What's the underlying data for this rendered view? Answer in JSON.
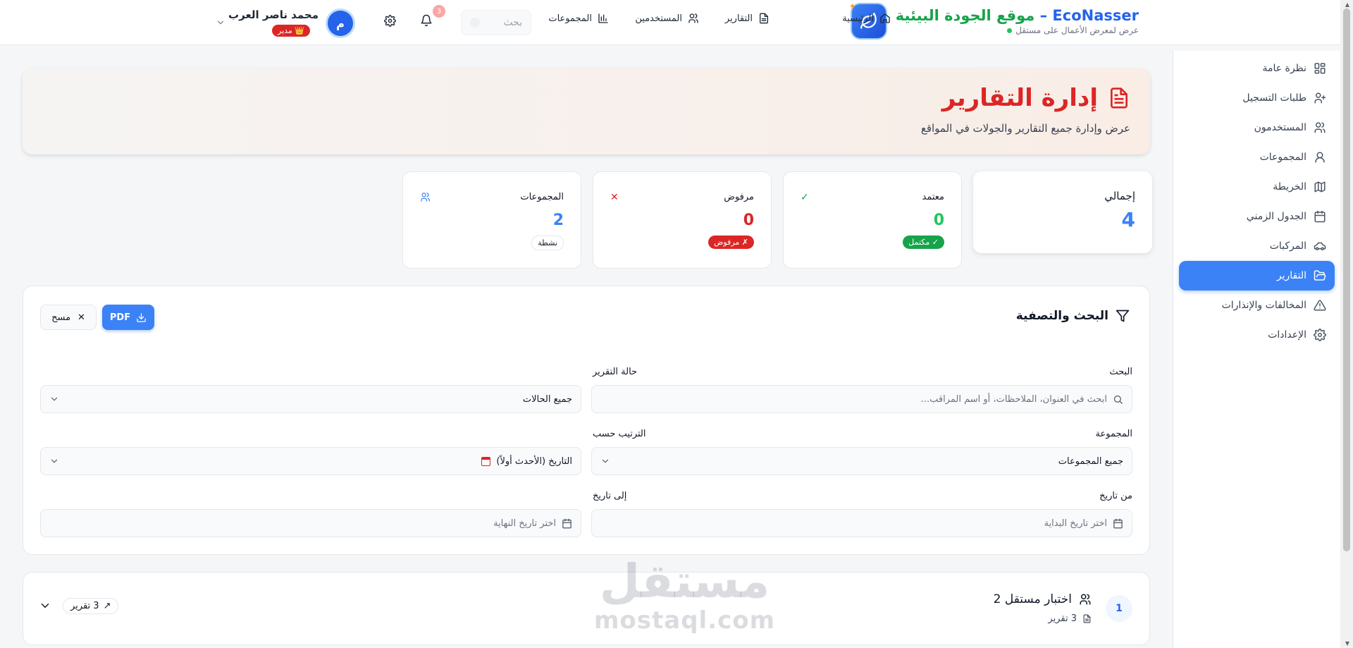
{
  "brand": {
    "title_en": "EcoNasser",
    "title_sep": " – ",
    "title_ar": "موقع الجودة البيئية",
    "subtitle": "عرض لمعرض الأعمال على مستقل"
  },
  "nav": {
    "home": "الرئيسية",
    "reports": "التقارير",
    "users": "المستخدمين",
    "groups": "المجموعات"
  },
  "search": {
    "placeholder": "بحث"
  },
  "notifications": {
    "count": "3"
  },
  "user": {
    "initial": "م",
    "name": "محمد ناصر العرب",
    "role": "👑 مدير"
  },
  "sidebar": {
    "items": [
      {
        "label": "نظرة عامة",
        "icon": "grid-icon"
      },
      {
        "label": "طلبات التسجيل",
        "icon": "user-plus-icon"
      },
      {
        "label": "المستخدمون",
        "icon": "users-icon"
      },
      {
        "label": "المجموعات",
        "icon": "user-icon"
      },
      {
        "label": "الخريطة",
        "icon": "map-icon"
      },
      {
        "label": "الجدول الزمني",
        "icon": "calendar-icon"
      },
      {
        "label": "المركبات",
        "icon": "car-icon"
      },
      {
        "label": "التقارير",
        "icon": "folder-icon"
      },
      {
        "label": "المخالفات والإنذارات",
        "icon": "warning-icon"
      },
      {
        "label": "الإعدادات",
        "icon": "gear-icon"
      }
    ],
    "active_index": 7
  },
  "header": {
    "title": "إدارة التقارير",
    "subtitle": "عرض وإدارة جميع التقارير والجولات في المواقع"
  },
  "stats": {
    "total": {
      "label": "إجمالي",
      "value": "4"
    },
    "approved": {
      "label": "معتمد",
      "value": "0",
      "badge": "✓ مكتمل"
    },
    "rejected": {
      "label": "مرفوض",
      "value": "0",
      "badge": "✗ مرفوض"
    },
    "groups": {
      "label": "المجموعات",
      "value": "2",
      "badge": "نشطة"
    }
  },
  "filters": {
    "title": "البحث والتصفية",
    "pdf_label": "PDF",
    "clear_label": "مسح",
    "search_label": "البحث",
    "search_placeholder": "ابحث في العنوان، الملاحظات، أو اسم المراقب...",
    "status_label": "حالة التقرير",
    "status_value": "جميع الحالات",
    "group_label": "المجموعة",
    "group_value": "جميع المجموعات",
    "sort_label": "الترتيب حسب",
    "sort_value": "التاريخ (الأحدث أولاً)",
    "from_label": "من تاريخ",
    "from_placeholder": "اختر تاريخ البداية",
    "to_label": "إلى تاريخ",
    "to_placeholder": "اختر تاريخ النهاية"
  },
  "group_row": {
    "number": "1",
    "title": "اختبار مستقل 2",
    "sub": "3 تقرير",
    "pill": "3 تقرير"
  },
  "watermark": {
    "ar": "مستقل",
    "en": "mostaql.com"
  },
  "colors": {
    "primary": "#3b82f6",
    "danger": "#dc2626",
    "success": "#16a34a"
  }
}
